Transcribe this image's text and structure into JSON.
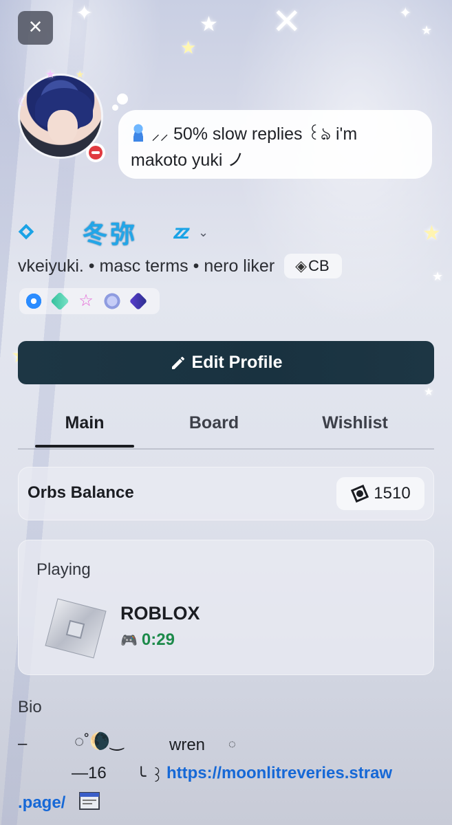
{
  "header": {
    "close_icon": "close-icon"
  },
  "status": {
    "emoji": "person-icon",
    "text_line1": "⸝⸝ 50% slow replies ꒰ঌ  i'm",
    "text_line2": "makoto yuki ノ"
  },
  "profile": {
    "display_name": "冬弥",
    "sleep_icon": "zz-icon",
    "tags_text": "vkeiyuki. • masc terms • nero liker",
    "clan_tag": "CB",
    "presence": "do-not-disturb"
  },
  "badges": [
    "nitro-badge",
    "boost-badge",
    "quest-badge",
    "hype-badge",
    "orb-badge"
  ],
  "actions": {
    "edit_profile": "Edit Profile"
  },
  "tabs": [
    {
      "label": "Main"
    },
    {
      "label": "Board"
    },
    {
      "label": "Wishlist"
    }
  ],
  "orbs": {
    "label": "Orbs Balance",
    "value": "1510"
  },
  "activity": {
    "title": "Playing",
    "game": "ROBLOX",
    "elapsed": "0:29"
  },
  "bio": {
    "title": "Bio",
    "line1_a": "–",
    "line1_b": "◌˚🌘‿",
    "line1_c": "wren",
    "line1_d": "◌",
    "line2_a": "—16",
    "line2_b": "╰ ꒱",
    "line2_link": "https://moonlitreveries.straw",
    "line3_link": ".page/",
    "line3_icon": "window-icon"
  },
  "colors": {
    "accent": "#1aa3e6",
    "edit_button": "#1b3442",
    "link": "#1668d6",
    "dnd": "#e03a40",
    "elapsed": "#1c8a4a"
  }
}
